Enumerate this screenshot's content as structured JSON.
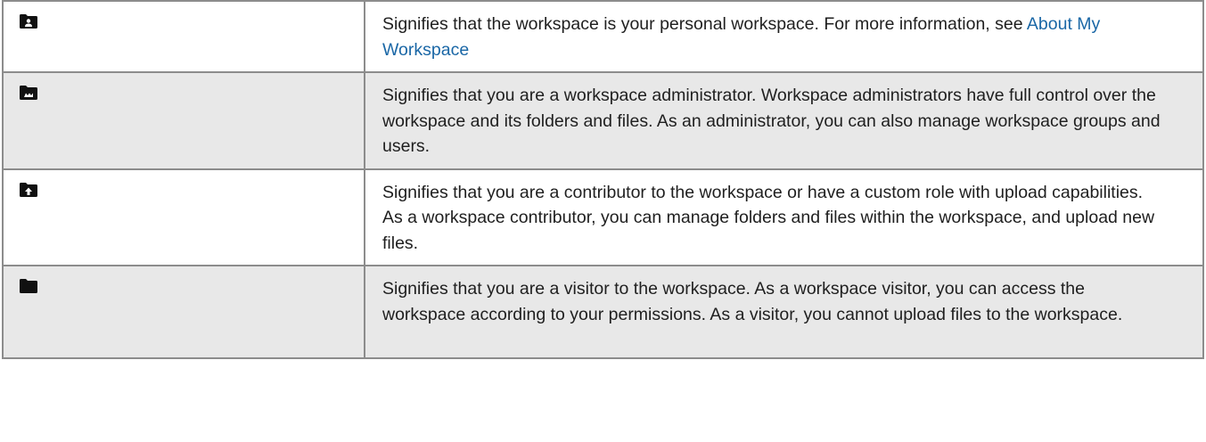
{
  "rows": [
    {
      "icon": "personal-workspace-folder-icon",
      "text": "Signifies that the workspace is your personal workspace. For more information, see ",
      "link": "About My Workspace"
    },
    {
      "icon": "administrator-workspace-folder-icon",
      "text": "Signifies that you are a workspace administrator. Workspace administrators have full control over the workspace and its folders and files. As an administrator, you can also manage workspace groups and users."
    },
    {
      "icon": "contributor-workspace-folder-icon",
      "text": "Signifies that you are a contributor to the workspace or have a custom role with upload capabilities. As a workspace contributor, you can manage folders and files within the workspace, and upload new files."
    },
    {
      "icon": "visitor-workspace-folder-icon",
      "text": "Signifies that you are a visitor to the workspace. As a workspace visitor, you can access the workspace according to your permissions. As a visitor, you cannot upload files to the workspace."
    }
  ],
  "colors": {
    "link": "#1a67a6",
    "row_gray": "#e8e8e8",
    "border": "#8c8c8c",
    "icon": "#111111"
  }
}
